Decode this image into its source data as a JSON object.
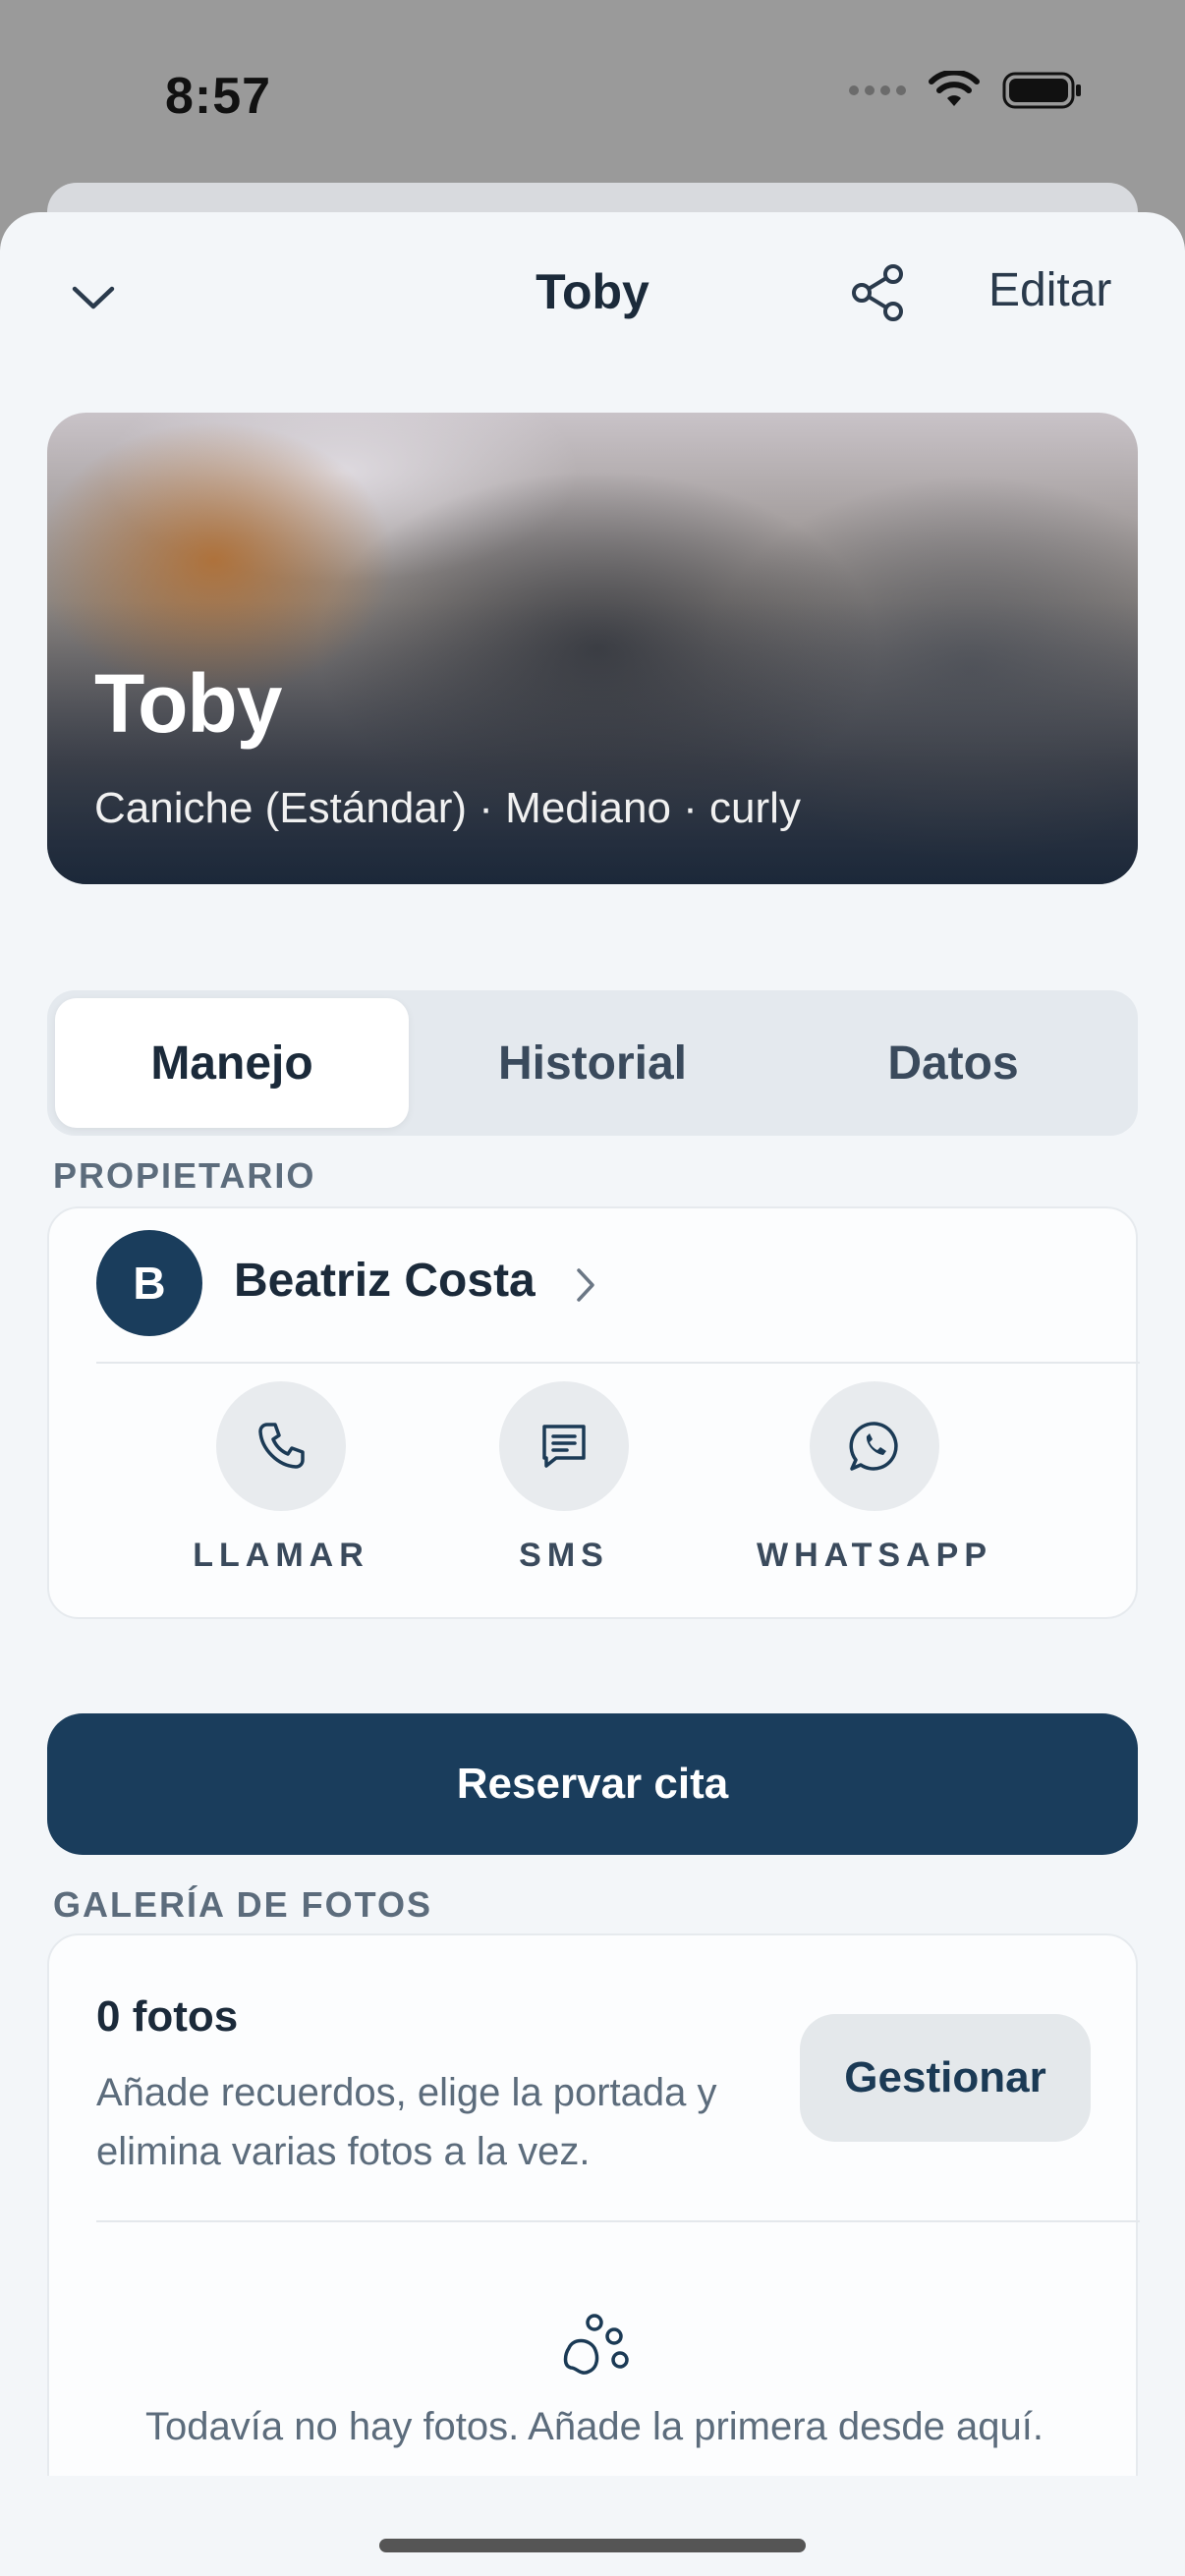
{
  "status_bar": {
    "time": "8:57"
  },
  "nav": {
    "title": "Toby",
    "edit_label": "Editar"
  },
  "hero": {
    "name": "Toby",
    "subtitle": "Caniche (Estándar) · Mediano · curly"
  },
  "tabs": [
    {
      "label": "Manejo",
      "active": true
    },
    {
      "label": "Historial",
      "active": false
    },
    {
      "label": "Datos",
      "active": false
    }
  ],
  "owner_section": {
    "label": "PROPIETARIO",
    "avatar_initial": "B",
    "name": "Beatriz Costa",
    "actions": [
      {
        "label": "LLAMAR",
        "icon": "phone-icon"
      },
      {
        "label": "SMS",
        "icon": "message-icon"
      },
      {
        "label": "WHATSAPP",
        "icon": "whatsapp-icon"
      }
    ]
  },
  "book_button": "Reservar cita",
  "gallery": {
    "label": "GALERÍA DE FOTOS",
    "count": "0 fotos",
    "description": "Añade recuerdos, elige la portada y elimina varias fotos a la vez.",
    "manage_label": "Gestionar",
    "empty_text": "Todavía no hay fotos. Añade la primera desde aquí."
  },
  "colors": {
    "primary": "#1a3d5c",
    "background": "#f3f6f9",
    "card": "#fcfdfe"
  }
}
